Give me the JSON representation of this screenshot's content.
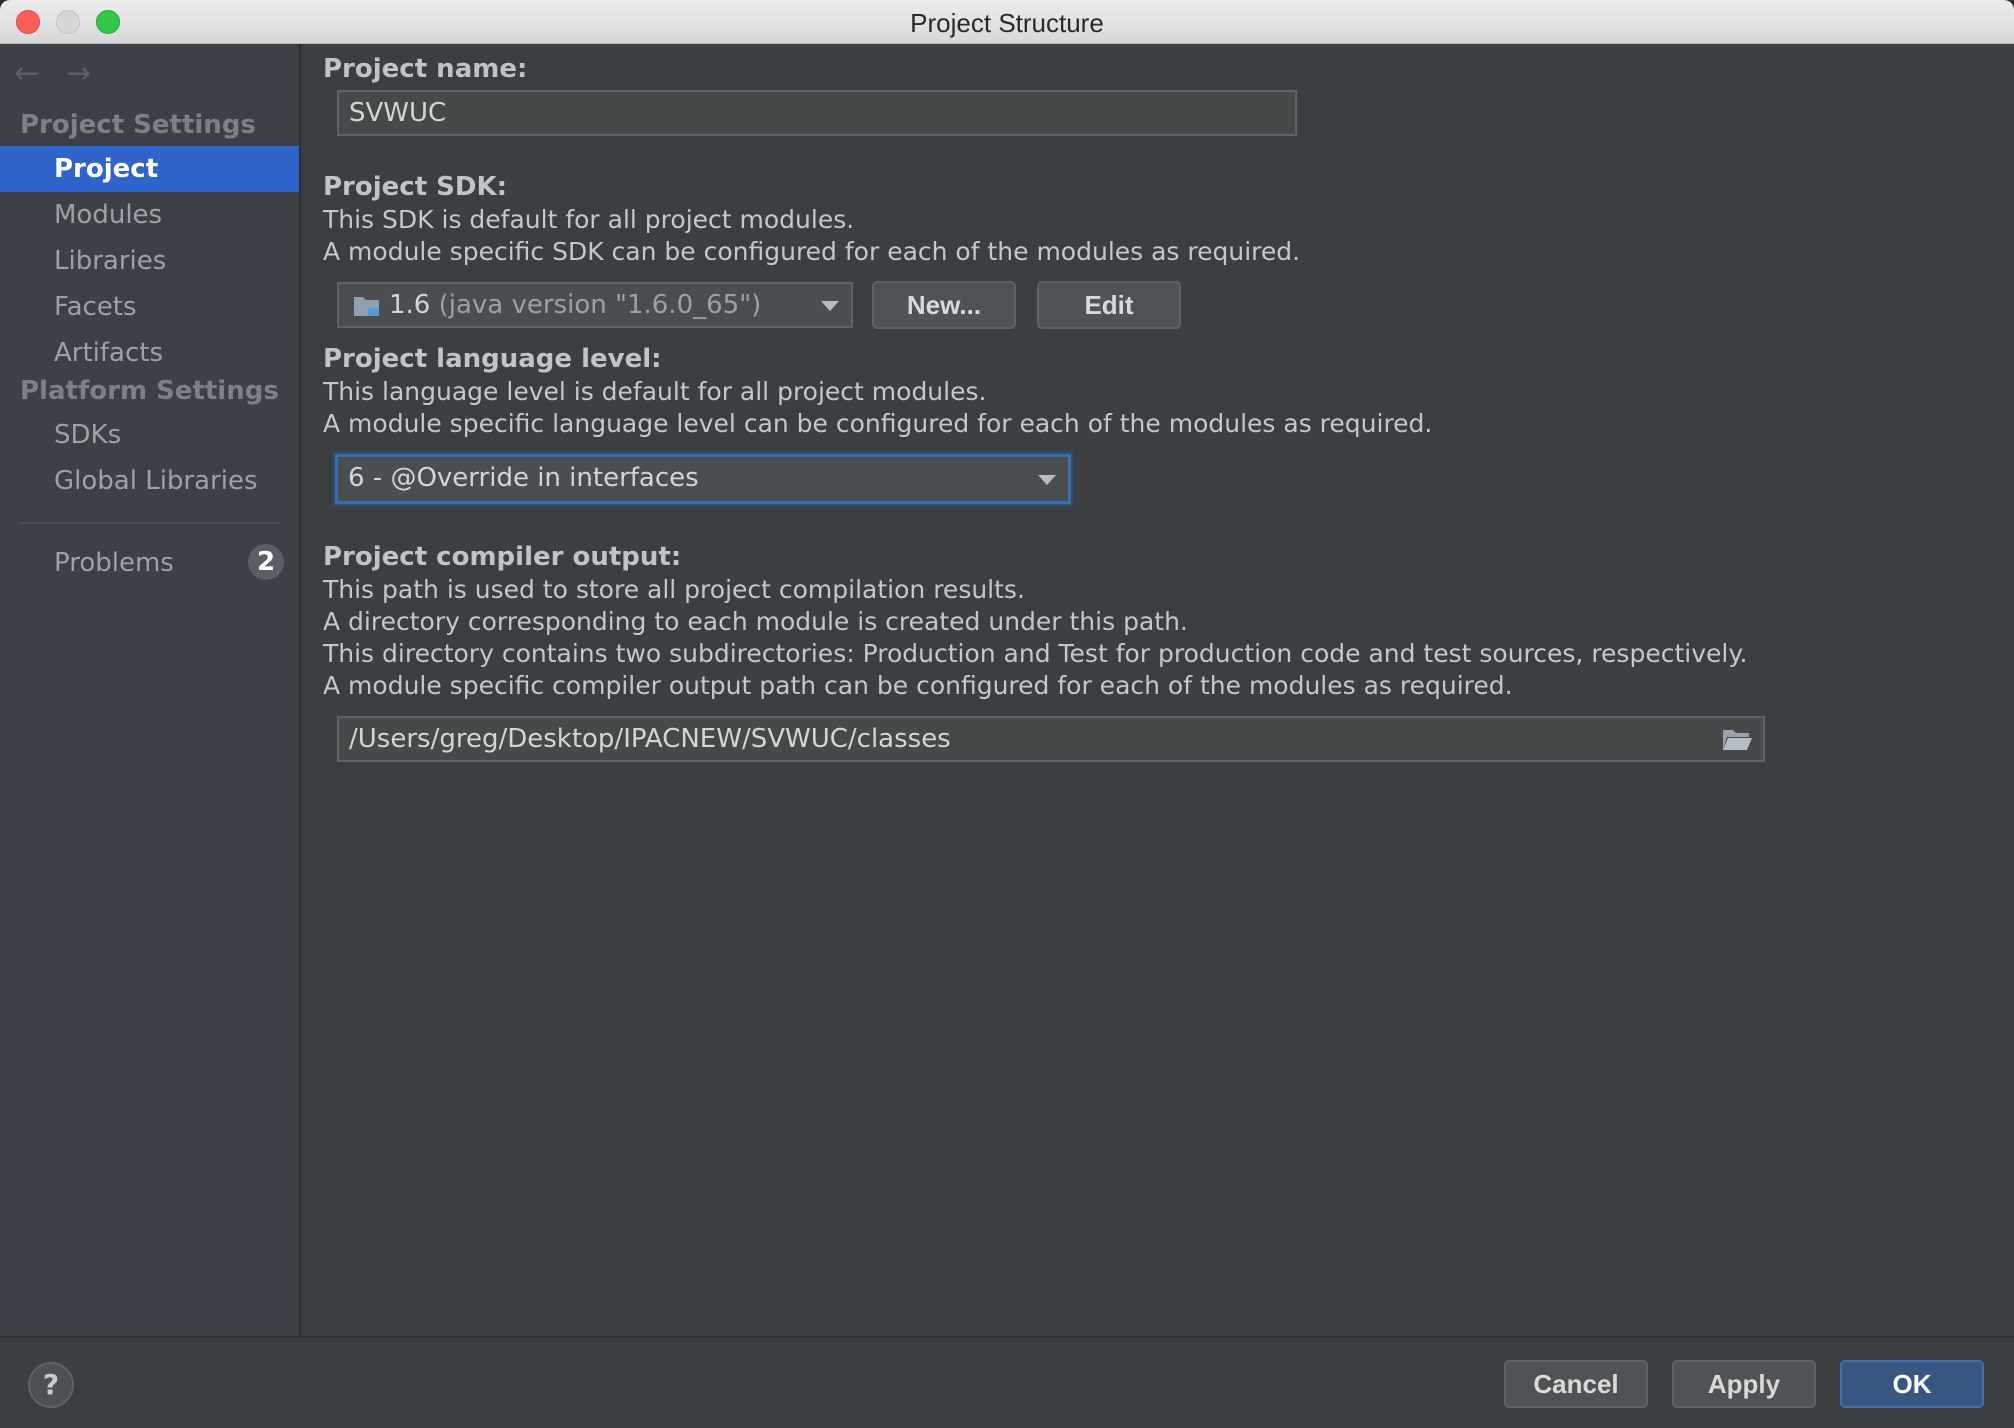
{
  "window": {
    "title": "Project Structure"
  },
  "sidebar": {
    "project_settings_heading": "Project Settings",
    "project_items": [
      {
        "label": "Project"
      },
      {
        "label": "Modules"
      },
      {
        "label": "Libraries"
      },
      {
        "label": "Facets"
      },
      {
        "label": "Artifacts"
      }
    ],
    "platform_settings_heading": "Platform Settings",
    "platform_items": [
      {
        "label": "SDKs"
      },
      {
        "label": "Global Libraries"
      }
    ],
    "problems_label": "Problems",
    "problems_count": "2"
  },
  "project": {
    "name_label": "Project name:",
    "name_value": "SVWUC",
    "sdk_label": "Project SDK:",
    "sdk_desc_1": "This SDK is default for all project modules.",
    "sdk_desc_2": "A module specific SDK can be configured for each of the modules as required.",
    "sdk_version": "1.6",
    "sdk_detail": "(java version \"1.6.0_65\")",
    "new_button": "New...",
    "edit_button": "Edit",
    "language_label": "Project language level:",
    "language_desc_1": "This language level is default for all project modules.",
    "language_desc_2": "A module specific language level can be configured for each of the modules as required.",
    "language_value": "6 - @Override in interfaces",
    "output_label": "Project compiler output:",
    "output_desc_1": "This path is used to store all project compilation results.",
    "output_desc_2": "A directory corresponding to each module is created under this path.",
    "output_desc_3": "This directory contains two subdirectories: Production and Test for production code and test sources, respectively.",
    "output_desc_4": "A module specific compiler output path can be configured for each of the modules as required.",
    "output_path": "/Users/greg/Desktop/IPACNEW/SVWUC/classes"
  },
  "footer": {
    "help": "?",
    "cancel": "Cancel",
    "apply": "Apply",
    "ok": "OK"
  },
  "colors": {
    "accent": "#2f65ca",
    "primary_button": "#365880"
  }
}
